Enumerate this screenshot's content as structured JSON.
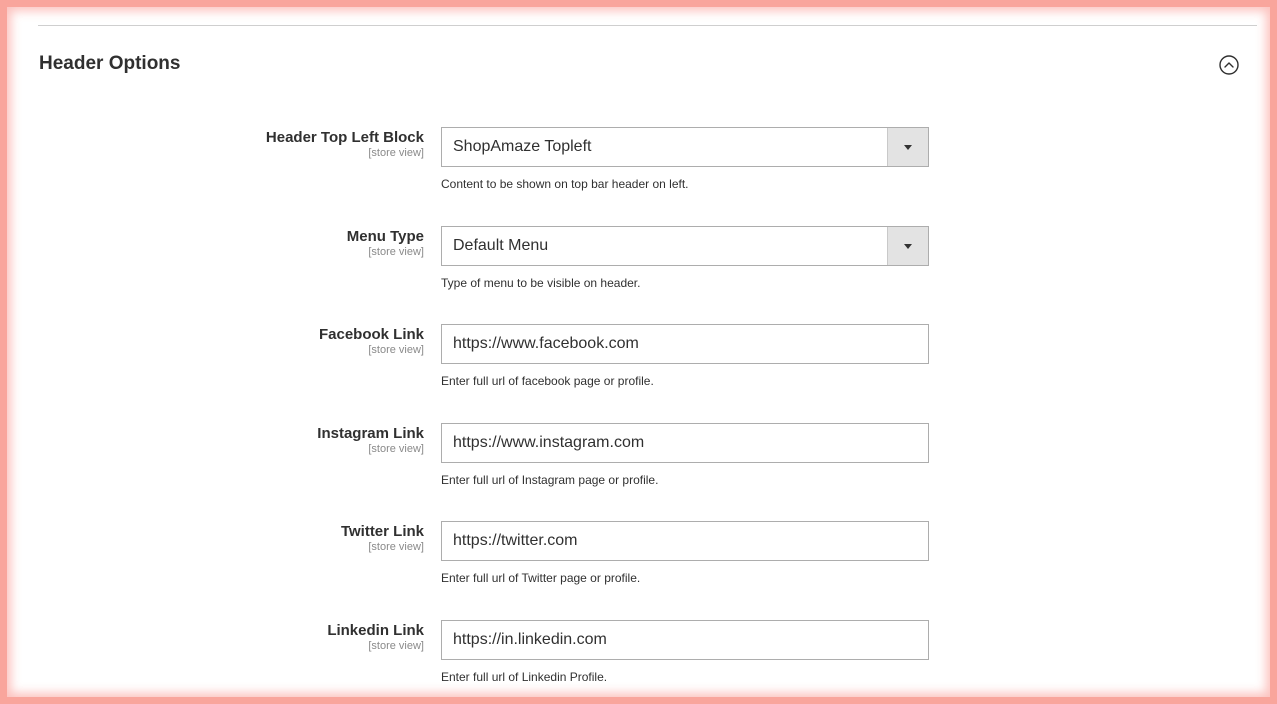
{
  "section": {
    "title": "Header Options",
    "collapse_icon": "chevron-up-circle-icon"
  },
  "fields": [
    {
      "label": "Header Top Left Block",
      "scope": "[store view]",
      "type": "select",
      "value": "ShopAmaze Topleft",
      "note": "Content to be shown on top bar header on left."
    },
    {
      "label": "Menu Type",
      "scope": "[store view]",
      "type": "select",
      "value": "Default Menu",
      "note": "Type of menu to be visible on header."
    },
    {
      "label": "Facebook Link",
      "scope": "[store view]",
      "type": "text",
      "value": "https://www.facebook.com",
      "note": "Enter full url of facebook page or profile."
    },
    {
      "label": "Instagram Link",
      "scope": "[store view]",
      "type": "text",
      "value": "https://www.instagram.com",
      "note": "Enter full url of Instagram page or profile."
    },
    {
      "label": "Twitter Link",
      "scope": "[store view]",
      "type": "text",
      "value": "https://twitter.com",
      "note": "Enter full url of Twitter page or profile."
    },
    {
      "label": "Linkedin Link",
      "scope": "[store view]",
      "type": "text",
      "value": "https://in.linkedin.com",
      "note": "Enter full url of Linkedin Profile."
    }
  ]
}
